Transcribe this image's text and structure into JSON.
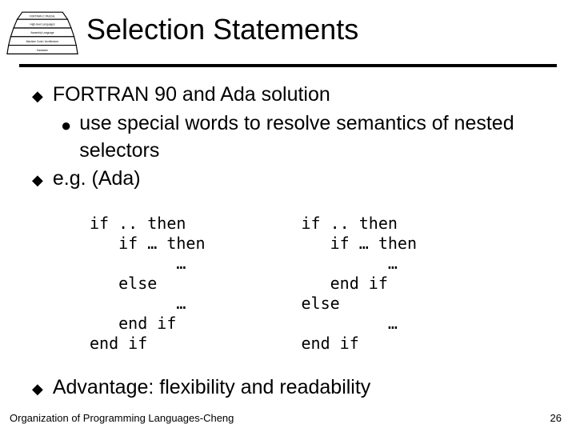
{
  "slide": {
    "title": "Selection Statements",
    "bullets": {
      "b1_text": "FORTRAN 90 and Ada solution",
      "b1a_text": "use special words to resolve semantics of nested selectors",
      "b2_text": "e.g. (Ada)",
      "b3_text": "Advantage: flexibility and readability"
    },
    "code_left": "if .. then\n   if … then\n         …\n   else\n         …\n   end if\nend if",
    "code_right": "if .. then\n   if … then\n         …\n   end if\nelse\n         …\nend if",
    "footer": "Organization of Programming Languages-Cheng",
    "page_number": "26"
  }
}
